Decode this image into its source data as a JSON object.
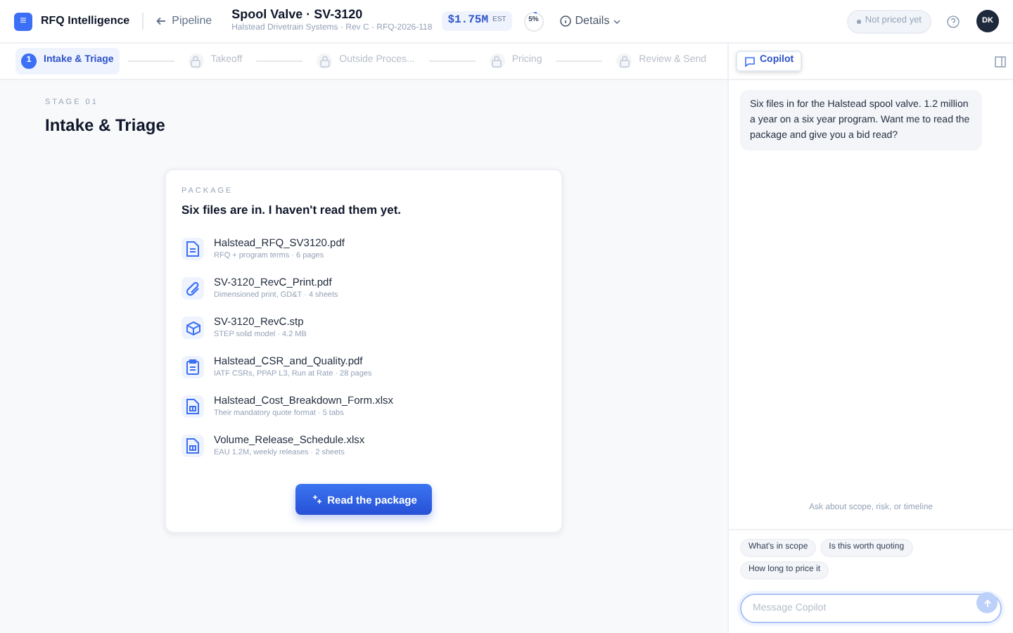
{
  "app": {
    "logo": "≡",
    "name": "RFQ Intelligence",
    "back_label": "Pipeline"
  },
  "quote": {
    "title": "Spool Valve · SV-3120",
    "subtitle": "Halstead Drivetrain Systems · Rev C · RFQ-2026-118",
    "value": "$1.75M",
    "value_tag": "EST",
    "progress": {
      "label": "5%",
      "level": 0.05
    },
    "details_label": "Details"
  },
  "status": {
    "label": "Not priced yet"
  },
  "user": {
    "initials": "DK"
  },
  "steps": [
    {
      "label": "Intake & Triage",
      "number": "1",
      "selected": true,
      "locked": false
    },
    {
      "label": "Takeoff",
      "selected": false,
      "locked": true
    },
    {
      "label": "Outside Proces...",
      "selected": false,
      "locked": true
    },
    {
      "label": "Pricing",
      "selected": false,
      "locked": true
    },
    {
      "label": "Review & Send",
      "selected": false,
      "locked": true
    }
  ],
  "stage": {
    "eyebrow": "STAGE 01",
    "title": "Intake & Triage"
  },
  "package": {
    "eyebrow": "PACKAGE",
    "heading": "Six files are in. I haven't read them yet.",
    "files": [
      {
        "kind": "document",
        "name": "Halstead_RFQ_SV3120.pdf",
        "meta": "RFQ + program terms · 6 pages"
      },
      {
        "kind": "attachment",
        "name": "SV-3120_RevC_Print.pdf",
        "meta": "Dimensioned print, GD&T · 4 sheets"
      },
      {
        "kind": "model",
        "name": "SV-3120_RevC.stp",
        "meta": "STEP solid model · 4.2 MB"
      },
      {
        "kind": "clipboard",
        "name": "Halstead_CSR_and_Quality.pdf",
        "meta": "IATF CSRs, PPAP L3, Run at Rate · 28 pages"
      },
      {
        "kind": "sheet",
        "name": "Halstead_Cost_Breakdown_Form.xlsx",
        "meta": "Their mandatory quote format · 5 tabs"
      },
      {
        "kind": "sheet",
        "name": "Volume_Release_Schedule.xlsx",
        "meta": "EAU 1.2M, weekly releases · 2 sheets"
      }
    ],
    "action": "Read the package"
  },
  "copilot": {
    "tab": "Copilot",
    "message": "Six files in for the Halstead spool valve. 1.2 million a year on a six year program. Want me to read the package and give you a bid read?",
    "hint": "Ask about scope, risk, or timeline",
    "suggestions": [
      "What's in scope",
      "Is this worth quoting",
      "How long to price it"
    ],
    "input": {
      "placeholder": "Message Copilot"
    }
  }
}
